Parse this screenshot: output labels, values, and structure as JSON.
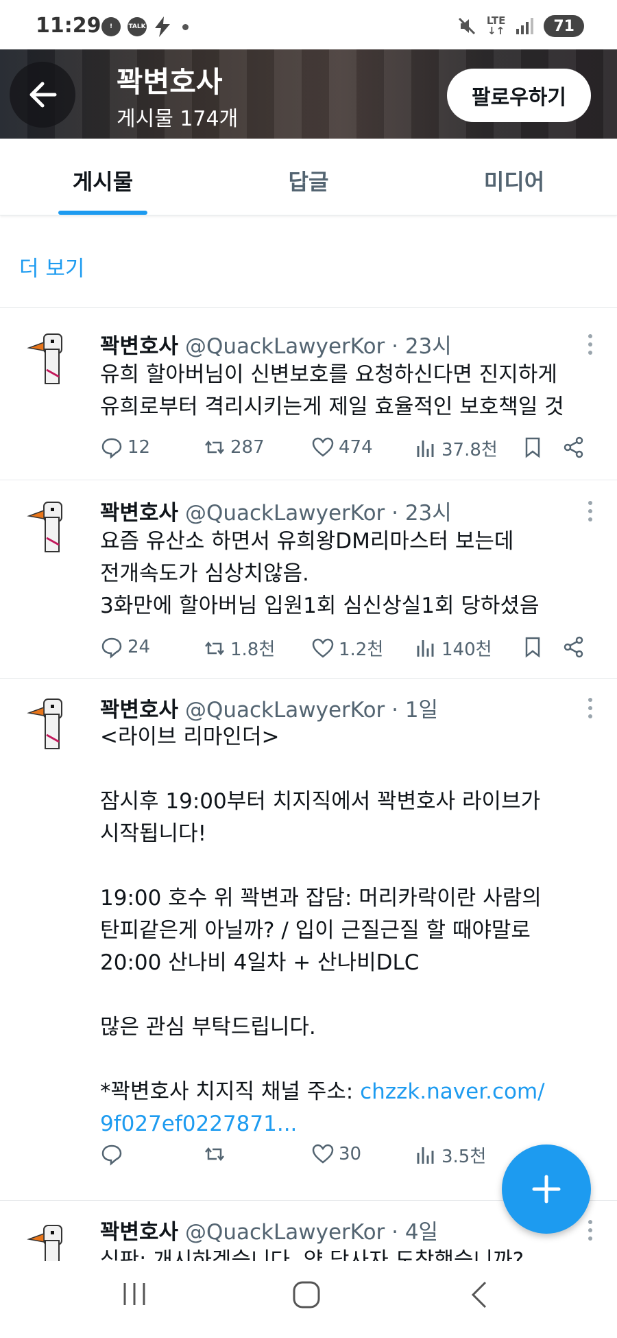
{
  "status_bar": {
    "time": "11:29",
    "talk_badge": "TALK",
    "lte": "LTE",
    "battery": "71"
  },
  "header": {
    "title": "꽉변호사",
    "post_count": "게시물 174개",
    "follow_label": "팔로우하기"
  },
  "tabs": [
    {
      "label": "게시물",
      "active": true
    },
    {
      "label": "답글",
      "active": false
    },
    {
      "label": "미디어",
      "active": false
    }
  ],
  "more_link": "더 보기",
  "tweets": [
    {
      "name": "꽉변호사",
      "meta": "@QuackLawyerKor · 23시",
      "body": "유희 할아버님이 신변보호를 요청하신다면 진지하게\n유희로부터 격리시키는게 제일 효율적인 보호책일 것",
      "replies": "12",
      "retweets": "287",
      "likes": "474",
      "views": "37.8천"
    },
    {
      "name": "꽉변호사",
      "meta": "@QuackLawyerKor · 23시",
      "body": "요즘 유산소 하면서 유희왕DM리마스터 보는데\n전개속도가 심상치않음.\n3화만에 할아버님 입원1회 심신상실1회 당하셨음",
      "replies": "24",
      "retweets": "1.8천",
      "likes": "1.2천",
      "views": "140천"
    },
    {
      "name": "꽉변호사",
      "meta": "@QuackLawyerKor · 1일",
      "body": "<라이브 리마인더>\n\n잠시후 19:00부터 치지직에서 꽉변호사 라이브가\n시작됩니다!\n\n19:00 호수 위 꽉변과 잡담: 머리카락이란 사람의\n탄피같은게 아닐까? / 입이 근질근질 할 때야말로\n20:00 산나비 4일차 + 산나비DLC\n\n많은 관심 부탁드립니다.\n\n*꽉변호사 치지직 채널 주소: ",
      "link": "chzzk.naver.com/\n9f027ef0227871...",
      "replies": "",
      "retweets": "",
      "likes": "30",
      "views": "3.5천"
    },
    {
      "name": "꽉변호사",
      "meta": "@QuackLawyerKor · 4일",
      "body": "심판: 개시하겠습니다. 양 당사자 도착했습니까?"
    }
  ],
  "icons": {
    "reply": "comment-icon",
    "retweet": "retweet-icon",
    "like": "heart-icon",
    "views": "bar-chart-icon",
    "bookmark": "bookmark-icon",
    "share": "share-icon",
    "compose": "plus-icon"
  },
  "colors": {
    "accent": "#1d9bf0",
    "text": "#0f1419",
    "secondary": "#536471"
  }
}
